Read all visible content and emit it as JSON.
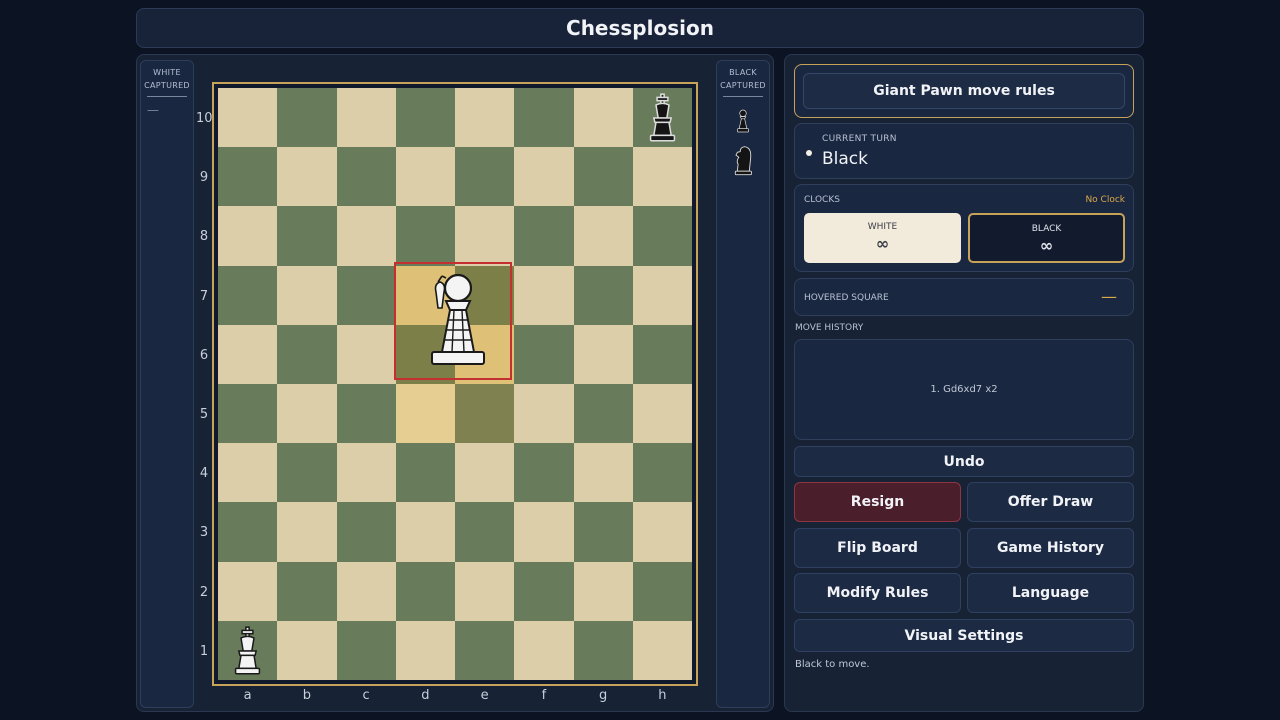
{
  "title": "Chessplosion",
  "captured": {
    "white_label": "WHITE CAPTURED",
    "white_empty": "—",
    "black_label": "BLACK CAPTURED",
    "black_pieces": [
      "black-pawn",
      "black-knight"
    ]
  },
  "board": {
    "files": [
      "a",
      "b",
      "c",
      "d",
      "e",
      "f",
      "g",
      "h"
    ],
    "ranks": [
      "10",
      "9",
      "8",
      "7",
      "6",
      "5",
      "4",
      "3",
      "2",
      "1"
    ],
    "pieces": [
      {
        "square": "h10",
        "piece": "black-king"
      },
      {
        "square": "a1",
        "piece": "white-king"
      },
      {
        "square": "d6-e7",
        "piece": "white-giant-pawn"
      }
    ],
    "highlighted_squares": [
      "d6",
      "d7",
      "e6",
      "e7"
    ],
    "last_move_squares": [
      "d5",
      "e5"
    ],
    "colors": {
      "light": "#dccea9",
      "dark": "#687c5c",
      "frame": "#c7a259",
      "selection": "#c43030"
    }
  },
  "rules_button": "Giant Pawn move rules",
  "turn": {
    "label": "CURRENT TURN",
    "value": "Black"
  },
  "clocks": {
    "label": "CLOCKS",
    "mode": "No Clock",
    "white": {
      "name": "WHITE",
      "time": "∞"
    },
    "black": {
      "name": "BLACK",
      "time": "∞"
    }
  },
  "hovered": {
    "label": "HOVERED SQUARE",
    "value": "—"
  },
  "history": {
    "label": "MOVE HISTORY",
    "moves": [
      "1. Gd6xd7 x2"
    ]
  },
  "buttons": {
    "undo": "Undo",
    "resign": "Resign",
    "offer_draw": "Offer Draw",
    "flip_board": "Flip Board",
    "game_history": "Game History",
    "modify_rules": "Modify Rules",
    "language": "Language",
    "visual_settings": "Visual Settings"
  },
  "status": "Black to move.",
  "accent_colors": {
    "gold": "#c7a259",
    "resign": "#4a1e2b",
    "panel": "#172235"
  }
}
